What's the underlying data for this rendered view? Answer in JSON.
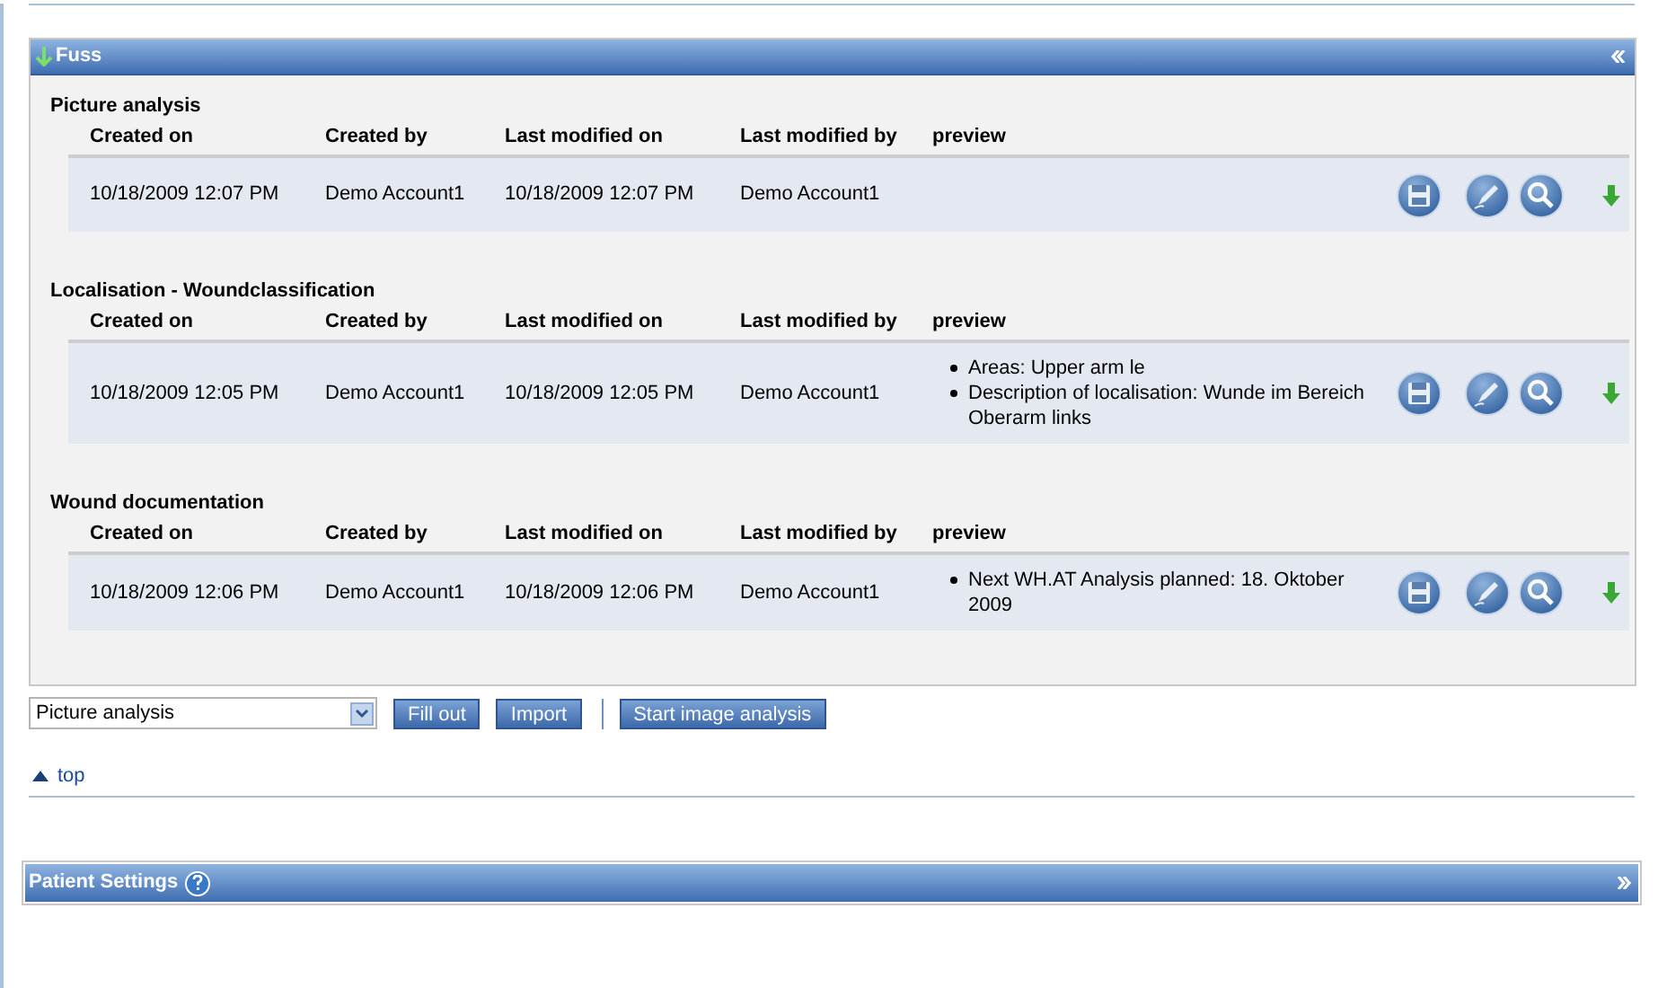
{
  "panel": {
    "title": "Fuss",
    "expanded": true
  },
  "sections": [
    {
      "title": "Picture analysis",
      "columns": [
        "Created on",
        "Created by",
        "Last modified on",
        "Last modified by",
        "preview"
      ],
      "rows": [
        {
          "created_on": "10/18/2009 12:07 PM",
          "created_by": "Demo Account1",
          "modified_on": "10/18/2009 12:07 PM",
          "modified_by": "Demo Account1",
          "preview": []
        }
      ]
    },
    {
      "title": "Localisation - Woundclassification",
      "columns": [
        "Created on",
        "Created by",
        "Last modified on",
        "Last modified by",
        "preview"
      ],
      "rows": [
        {
          "created_on": "10/18/2009 12:05 PM",
          "created_by": "Demo Account1",
          "modified_on": "10/18/2009 12:05 PM",
          "modified_by": "Demo Account1",
          "preview": [
            "Areas: Upper arm le",
            "Description of localisation: Wunde im Bereich Oberarm links"
          ]
        }
      ]
    },
    {
      "title": "Wound documentation",
      "columns": [
        "Created on",
        "Created by",
        "Last modified on",
        "Last modified by",
        "preview"
      ],
      "rows": [
        {
          "created_on": "10/18/2009 12:06 PM",
          "created_by": "Demo Account1",
          "modified_on": "10/18/2009 12:06 PM",
          "modified_by": "Demo Account1",
          "preview": [
            "Next WH.AT Analysis planned: 18. Oktober 2009"
          ]
        }
      ]
    }
  ],
  "form_select": {
    "value": "Picture analysis"
  },
  "buttons": [
    "Fill out",
    "Import"
  ],
  "analysis_button": "Start image analysis",
  "top_link": "top",
  "settings_panel": {
    "title": "Patient Settings",
    "expanded": false
  }
}
